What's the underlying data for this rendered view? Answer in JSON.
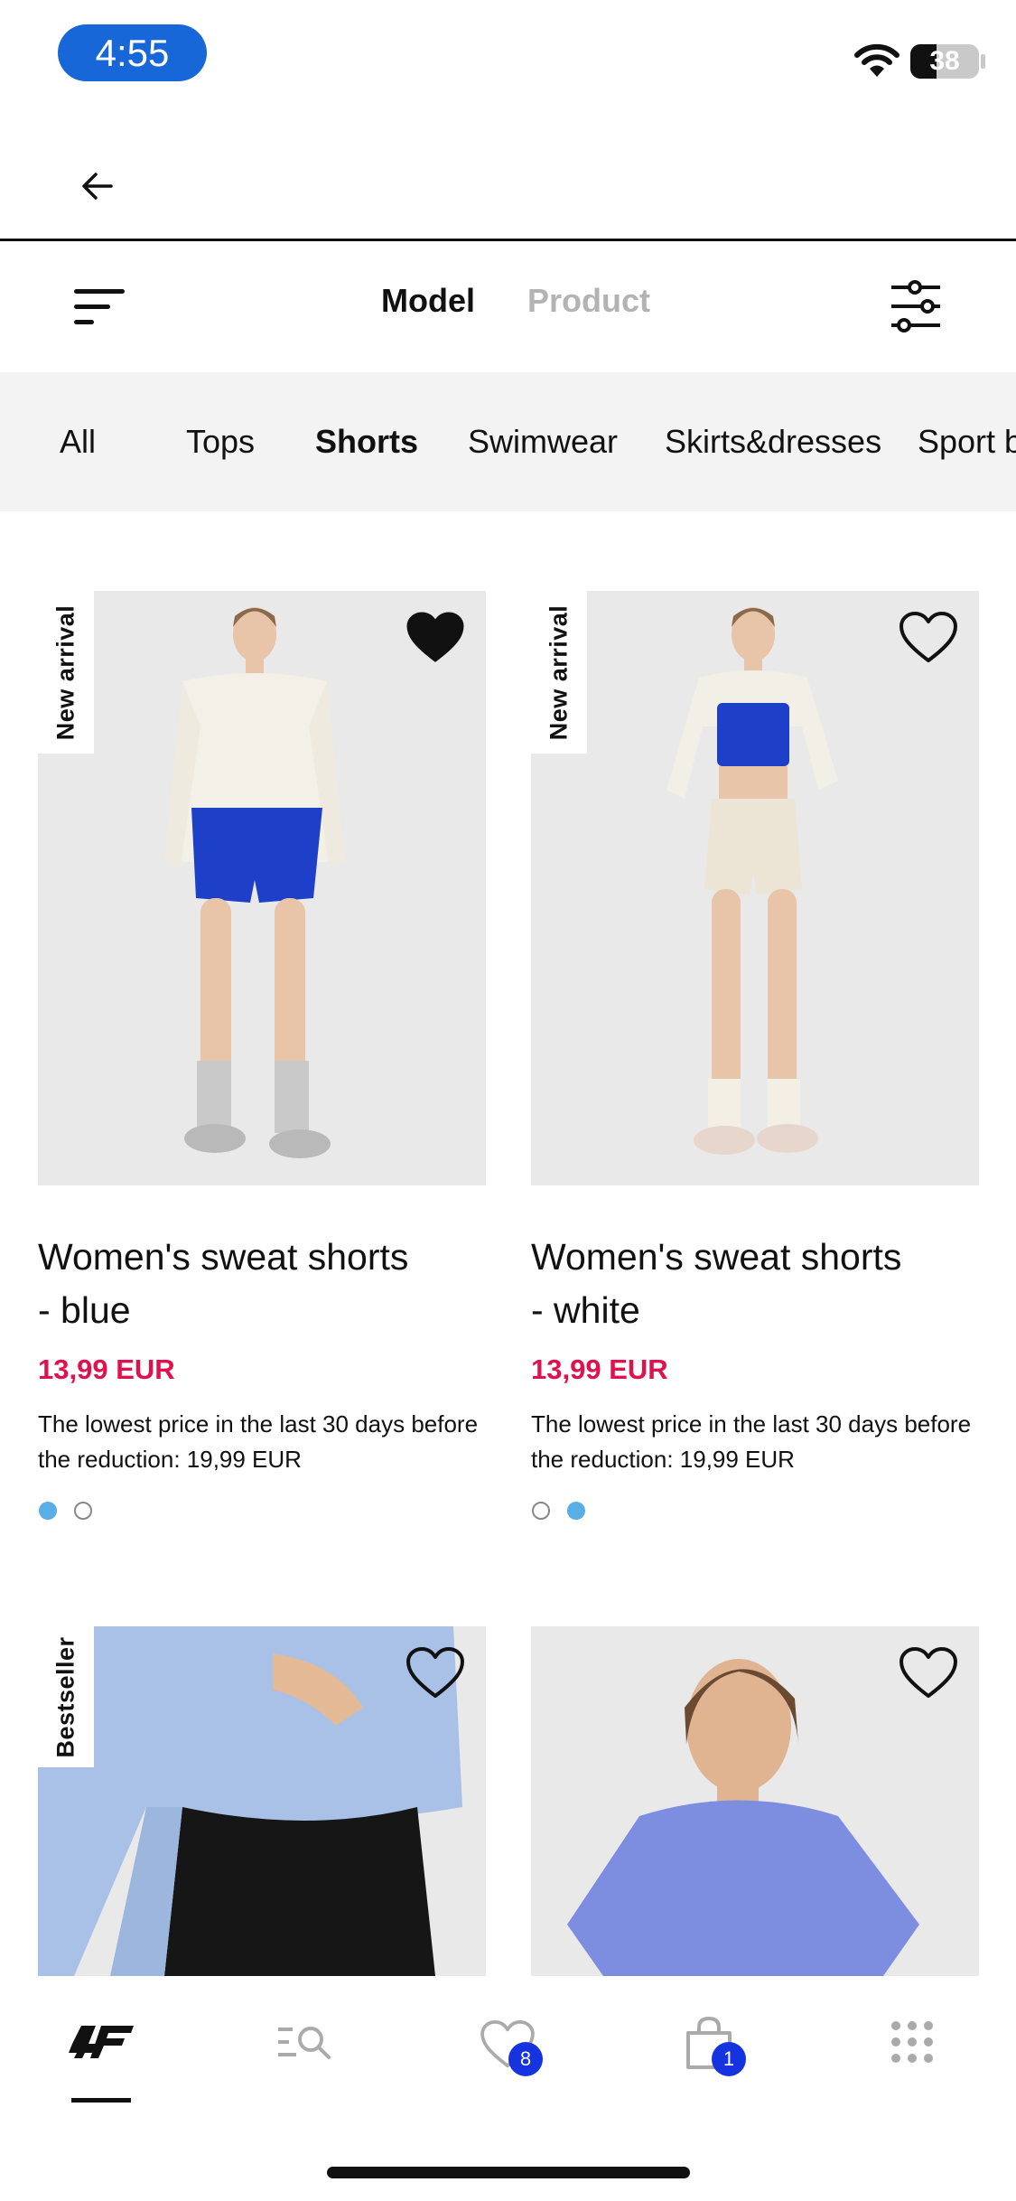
{
  "status_bar": {
    "time": "4:55",
    "battery": "38",
    "battery_level": 0.38
  },
  "toggle": {
    "model_label": "Model",
    "product_label": "Product",
    "active": "Model"
  },
  "categories": [
    {
      "label": "All",
      "active": false
    },
    {
      "label": "Tops",
      "active": false
    },
    {
      "label": "Shorts",
      "active": true
    },
    {
      "label": "Swimwear",
      "active": false
    },
    {
      "label": "Skirts&dresses",
      "active": false
    },
    {
      "label": "Sport b",
      "active": false
    }
  ],
  "products": [
    {
      "badge": "New arrival",
      "favorited": true,
      "name_line1": "Women's sweat shorts",
      "name_line2": "- blue",
      "price": "13,99 EUR",
      "lowest_price_line1": "The lowest price in the last 30 days before",
      "lowest_price_line2": "the reduction: 19,99 EUR",
      "colors": [
        "#5aaee6",
        "#ffffff"
      ],
      "selected_color": 0
    },
    {
      "badge": "New arrival",
      "favorited": false,
      "name_line1": "Women's sweat shorts",
      "name_line2": "- white",
      "price": "13,99 EUR",
      "lowest_price_line1": "The lowest price in the last 30 days before",
      "lowest_price_line2": "the reduction: 19,99 EUR",
      "colors": [
        "#ffffff",
        "#5aaee6"
      ],
      "selected_color": 1
    },
    {
      "badge": "Bestseller",
      "favorited": false
    },
    {
      "badge": "",
      "favorited": false
    }
  ],
  "bottom_nav": {
    "items": [
      {
        "icon": "4f-logo-icon",
        "label": "Home",
        "active": true
      },
      {
        "icon": "search-list-icon",
        "label": "Search"
      },
      {
        "icon": "heart-icon",
        "label": "Favorites",
        "badge": "8"
      },
      {
        "icon": "shopping-bag-icon",
        "label": "Cart",
        "badge": "1"
      },
      {
        "icon": "grid-menu-icon",
        "label": "More"
      }
    ]
  },
  "colors": {
    "price": "#e0124d",
    "badge_blue": "#1633e0",
    "time_pill": "#1767d8",
    "swatch_blue": "#5aaee6"
  }
}
